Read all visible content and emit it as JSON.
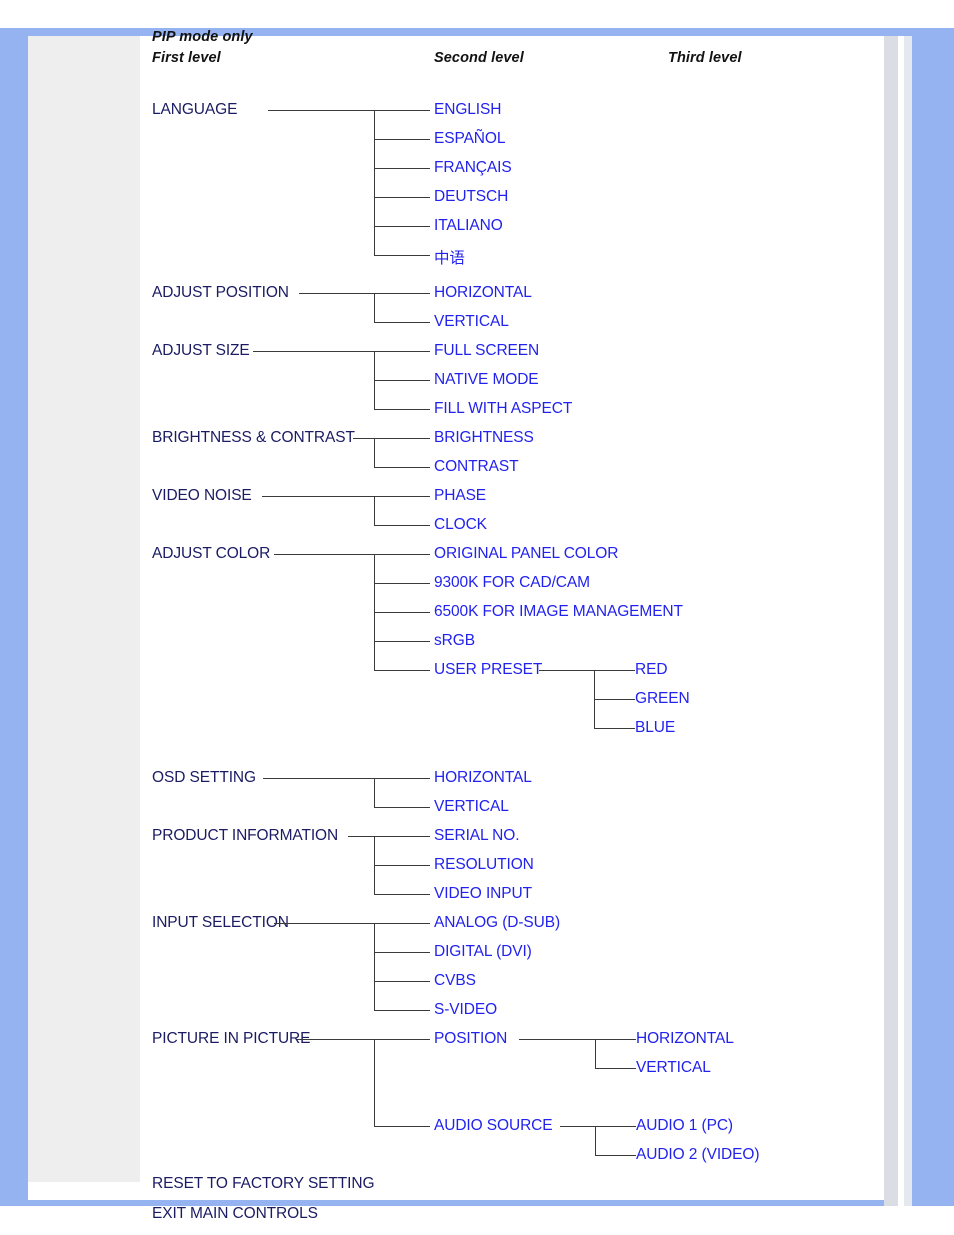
{
  "colors": {
    "frame_blue": "#94b3f0",
    "sidebar_gray": "#eeeeee",
    "level1_text": "#1b1b63",
    "level2_text": "#2222ee",
    "level3_text": "#2222ee",
    "header_text": "#121212",
    "tree_line": "#3a3a3a",
    "sheet_white": "#ffffff"
  },
  "headers": {
    "pip_note": "PIP mode only",
    "first_level": "First level",
    "second_level": "Second level",
    "third_level": "Third level"
  },
  "menu": [
    {
      "label": "LANGUAGE",
      "children": [
        {
          "label": "ENGLISH"
        },
        {
          "label": "ESPAÑOL"
        },
        {
          "label": "FRANÇAIS"
        },
        {
          "label": "DEUTSCH"
        },
        {
          "label": "ITALIANO"
        },
        {
          "label": "中语"
        }
      ]
    },
    {
      "label": "ADJUST POSITION",
      "children": [
        {
          "label": "HORIZONTAL"
        },
        {
          "label": "VERTICAL"
        }
      ]
    },
    {
      "label": "ADJUST SIZE",
      "children": [
        {
          "label": "FULL SCREEN"
        },
        {
          "label": "NATIVE MODE"
        },
        {
          "label": "FILL WITH ASPECT"
        }
      ]
    },
    {
      "label": "BRIGHTNESS & CONTRAST",
      "children": [
        {
          "label": "BRIGHTNESS"
        },
        {
          "label": "CONTRAST"
        }
      ]
    },
    {
      "label": "VIDEO NOISE",
      "children": [
        {
          "label": "PHASE"
        },
        {
          "label": "CLOCK"
        }
      ]
    },
    {
      "label": "ADJUST COLOR",
      "children": [
        {
          "label": "ORIGINAL PANEL COLOR"
        },
        {
          "label": "9300K FOR CAD/CAM"
        },
        {
          "label": "6500K FOR IMAGE MANAGEMENT"
        },
        {
          "label": "sRGB"
        },
        {
          "label": "USER PRESET",
          "children": [
            {
              "label": "RED"
            },
            {
              "label": "GREEN"
            },
            {
              "label": "BLUE"
            }
          ]
        }
      ]
    },
    {
      "label": "OSD SETTING",
      "children": [
        {
          "label": "HORIZONTAL"
        },
        {
          "label": "VERTICAL"
        }
      ]
    },
    {
      "label": "PRODUCT INFORMATION",
      "children": [
        {
          "label": "SERIAL NO."
        },
        {
          "label": "RESOLUTION"
        },
        {
          "label": "VIDEO INPUT"
        }
      ]
    },
    {
      "label": "INPUT SELECTION",
      "children": [
        {
          "label": "ANALOG (D-SUB)"
        },
        {
          "label": "DIGITAL (DVI)"
        },
        {
          "label": "CVBS"
        },
        {
          "label": "S-VIDEO"
        }
      ]
    },
    {
      "label": "PICTURE IN PICTURE",
      "children": [
        {
          "label": "POSITION",
          "children": [
            {
              "label": "HORIZONTAL"
            },
            {
              "label": "VERTICAL"
            }
          ]
        },
        {
          "label": "AUDIO SOURCE",
          "children": [
            {
              "label": "AUDIO 1 (PC)"
            },
            {
              "label": "AUDIO 2 (VIDEO)"
            }
          ]
        }
      ]
    },
    {
      "label": "RESET TO FACTORY SETTING",
      "children": []
    },
    {
      "label": "EXIT MAIN CONTROLS",
      "children": []
    }
  ]
}
